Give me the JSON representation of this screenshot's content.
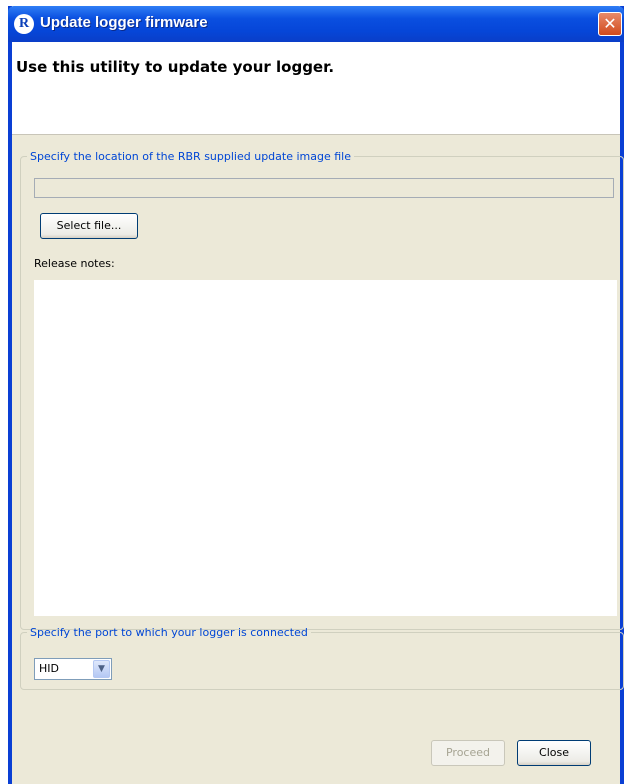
{
  "window": {
    "title": "Update logger firmware",
    "app_icon_glyph": "R",
    "close_glyph": "✕"
  },
  "banner": {
    "text": "Use this utility to update your logger."
  },
  "file_group": {
    "legend": "Specify the location of the RBR supplied update image file",
    "path_value": "",
    "select_button_label": "Select file...",
    "release_notes_label": "Release notes:",
    "release_notes_value": ""
  },
  "port_group": {
    "legend": "Specify the port to which your logger is connected",
    "selected_port": "HID",
    "dropdown_glyph": "▼"
  },
  "buttons": {
    "proceed_label": "Proceed",
    "proceed_enabled": false,
    "close_label": "Close"
  },
  "colors": {
    "titlebar": "#0a4fe0",
    "group_legend": "#0046d5",
    "dialog_background": "#ece9d8"
  }
}
